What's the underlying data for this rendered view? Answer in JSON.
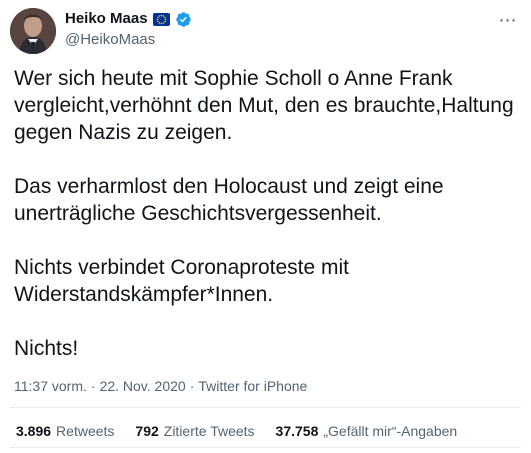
{
  "author": {
    "name": "Heiko Maas",
    "handle": "@HeikoMaas",
    "flag_icon": "eu-flag-icon",
    "verified_icon": "verified-badge-icon",
    "more_icon": "more-icon"
  },
  "tweet": {
    "paragraphs": [
      "Wer sich heute mit Sophie Scholl o Anne Frank vergleicht,verhöhnt den Mut, den es brauchte,Haltung gegen Nazis zu zeigen.",
      "Das verharmlost den Holocaust und zeigt eine unerträgliche Geschichtsvergessenheit.",
      "Nichts verbindet Coronaproteste mit Widerstandskämpfer*Innen.",
      "Nichts!"
    ],
    "time": "11:37 vorm.",
    "date": "22. Nov. 2020",
    "source": "Twitter for iPhone",
    "separator": "·"
  },
  "stats": [
    {
      "count": "3.896",
      "label": "Retweets"
    },
    {
      "count": "792",
      "label": "Zitierte Tweets"
    },
    {
      "count": "37.758",
      "label": "„Gefällt mir“-Angaben"
    }
  ],
  "colors": {
    "text": "#0f1419",
    "secondary": "#536471",
    "verified": "#1d9bf0",
    "eu_blue": "#003399",
    "eu_star": "#ffcc00",
    "divider": "#e6ecf0"
  }
}
